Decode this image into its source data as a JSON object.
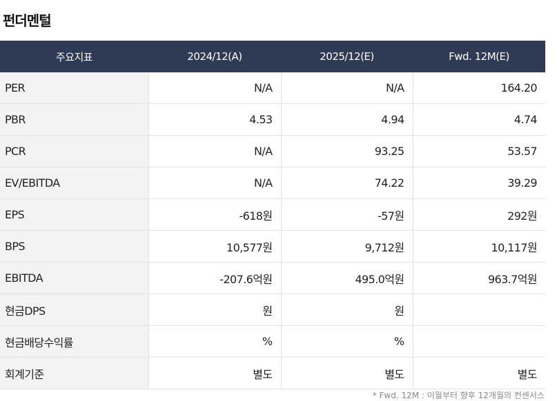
{
  "title": "펀더멘털",
  "header": {
    "col0": "주요지표",
    "col1": "2024/12(A)",
    "col2": "2025/12(E)",
    "col3": "Fwd. 12M(E)"
  },
  "rows": [
    {
      "label": "PER",
      "v1": "N/A",
      "v2": "N/A",
      "v3": "164.20"
    },
    {
      "label": "PBR",
      "v1": "4.53",
      "v2": "4.94",
      "v3": "4.74"
    },
    {
      "label": "PCR",
      "v1": "N/A",
      "v2": "93.25",
      "v3": "53.57"
    },
    {
      "label": "EV/EBITDA",
      "v1": "N/A",
      "v2": "74.22",
      "v3": "39.29"
    },
    {
      "label": "EPS",
      "v1": "-618원",
      "v2": "-57원",
      "v3": "292원"
    },
    {
      "label": "BPS",
      "v1": "10,577원",
      "v2": "9,712원",
      "v3": "10,117원"
    },
    {
      "label": "EBITDA",
      "v1": "-207.6억원",
      "v2": "495.0억원",
      "v3": "963.7억원"
    },
    {
      "label": "현금DPS",
      "v1": "원",
      "v2": "원",
      "v3": ""
    },
    {
      "label": "현금배당수익률",
      "v1": "%",
      "v2": "%",
      "v3": ""
    },
    {
      "label": "회계기준",
      "v1": "별도",
      "v2": "별도",
      "v3": "별도"
    }
  ],
  "footnote": "* Fwd. 12M : 이월부터 향후 12개월의 컨센서스"
}
